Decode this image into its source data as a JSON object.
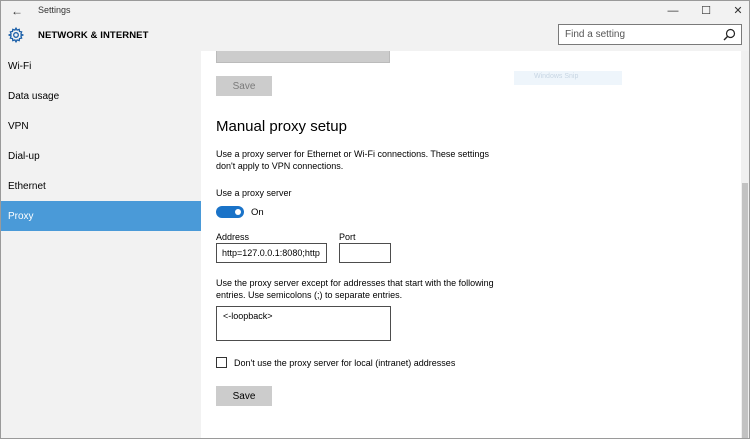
{
  "window": {
    "title": "Settings",
    "back_glyph": "←",
    "minimize_glyph": "—",
    "maximize_glyph": "☐",
    "close_glyph": "✕"
  },
  "header": {
    "section_title": "NETWORK & INTERNET",
    "search_placeholder": "Find a setting",
    "icons": [
      "gear-icon",
      "search-icon"
    ]
  },
  "sidebar": {
    "items": [
      {
        "label": "Wi-Fi",
        "active": false
      },
      {
        "label": "Data usage",
        "active": false
      },
      {
        "label": "VPN",
        "active": false
      },
      {
        "label": "Dial-up",
        "active": false
      },
      {
        "label": "Ethernet",
        "active": false
      },
      {
        "label": "Proxy",
        "active": true
      }
    ]
  },
  "main": {
    "top_save_label": "Save",
    "faint_text": "Windows Snip",
    "section_heading": "Manual proxy setup",
    "section_description": "Use a proxy server for Ethernet or Wi-Fi connections. These settings don't apply to VPN connections.",
    "use_proxy_label": "Use a proxy server",
    "toggle_state": "On",
    "address_label": "Address",
    "address_value": "http=127.0.0.1:8080;http",
    "port_label": "Port",
    "port_value": "",
    "exceptions_description": "Use the proxy server except for addresses that start with the following entries. Use semicolons (;) to separate entries.",
    "exceptions_value": "<-loopback>",
    "local_checkbox_label": "Don't use the proxy server for local (intranet) addresses",
    "local_checkbox_checked": false,
    "save_label": "Save"
  },
  "colors": {
    "accent": "#1a73c8",
    "sidebar_active": "#4a9ad8",
    "chrome_bg": "#f2f2f2",
    "button_bg": "#cccccc"
  }
}
